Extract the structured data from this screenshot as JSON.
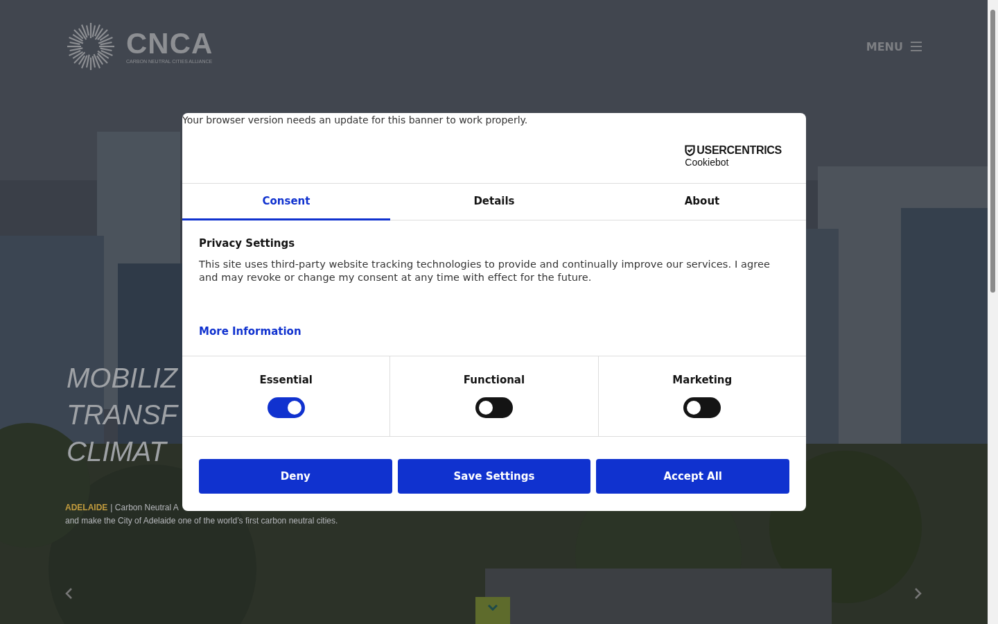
{
  "site": {
    "logo": {
      "name": "CNCA",
      "tagline": "CARBON NEUTRAL CITIES ALLIANCE"
    },
    "menu_label": "MENU"
  },
  "hero": {
    "headline_lines": [
      "MOBILIZ",
      "TRANSF",
      "CLIMAT"
    ],
    "caption": {
      "city": "ADELAIDE",
      "text": "| Carbon Neutral A",
      "line_2": "and make the City of Adelaide one of the world’s first carbon neutral cities."
    }
  },
  "cookie_dialog": {
    "notice": "Your browser version needs an update for this banner to work properly.",
    "provider": {
      "brand": "USERCENTRICS",
      "product": "Cookiebot"
    },
    "tabs": [
      {
        "label": "Consent",
        "selected": true
      },
      {
        "label": "Details",
        "selected": false
      },
      {
        "label": "About",
        "selected": false
      }
    ],
    "title": "Privacy Settings",
    "text": "This site uses third-party website tracking technologies to provide and continually improve our services. I agree and may revoke or change my consent at any time with effect for the future.",
    "link": "More Information",
    "categories": [
      {
        "label": "Essential",
        "checked": true
      },
      {
        "label": "Functional",
        "checked": false
      },
      {
        "label": "Marketing",
        "checked": false
      }
    ],
    "buttons": [
      "Deny",
      "Save Settings",
      "Accept All"
    ]
  }
}
